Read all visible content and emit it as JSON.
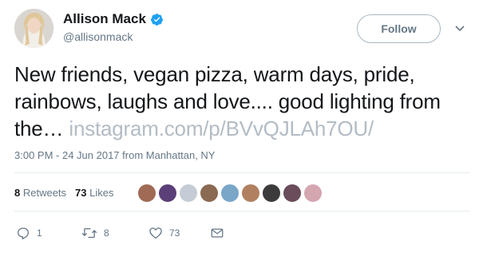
{
  "user": {
    "display_name": "Allison Mack",
    "screen_name": "@allisonmack",
    "verified_icon": "verified-badge-icon",
    "avatar_icon": "avatar"
  },
  "follow_button": {
    "label": "Follow"
  },
  "menu": {
    "icon": "chevron-down-icon"
  },
  "tweet": {
    "text": "New friends, vegan pizza, warm days, pride, rainbows, laughs and love.... good lighting from the… ",
    "link_text": "instagram.com/p/BVvQJLAh7OU/"
  },
  "meta": {
    "timestamp": "3:00 PM - 24 Jun 2017",
    "from_label": " from ",
    "location": "Manhattan, NY"
  },
  "stats": {
    "retweets_count": "8",
    "retweets_label": " Retweets",
    "likes_count": "73",
    "likes_label": " Likes",
    "liker_colors": [
      "#a06a55",
      "#5b3f78",
      "#c5ccd6",
      "#8a6a52",
      "#7aa6c8",
      "#b08060",
      "#3b3b3b",
      "#6a4c5a",
      "#d4a6b0"
    ]
  },
  "actions": {
    "reply_count": "1",
    "retweet_count": "8",
    "like_count": "73"
  },
  "colors": {
    "accent": "#1da1f2",
    "text": "#14171a",
    "secondary": "#657786",
    "link_faded": "#b3bcc4",
    "border": "#e6ecf0"
  }
}
